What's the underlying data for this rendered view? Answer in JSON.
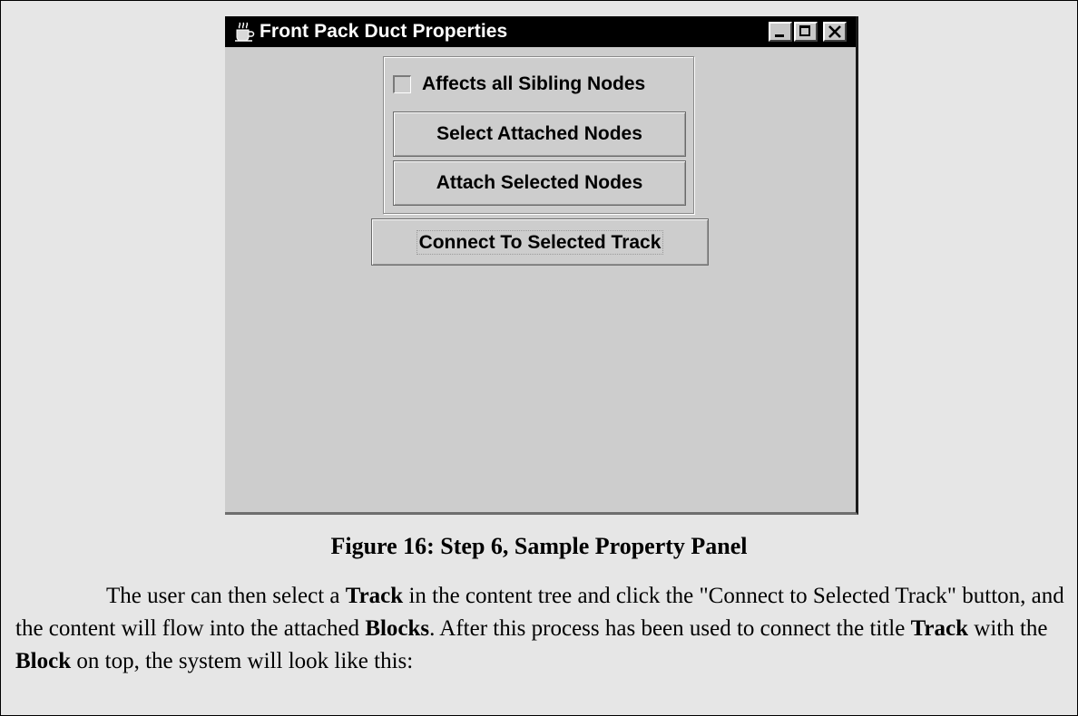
{
  "window": {
    "title": "Front Pack Duct Properties",
    "icon": "java-coffee-cup-icon",
    "controls": [
      "minimize",
      "maximize",
      "close"
    ]
  },
  "panel": {
    "checkbox": {
      "label": "Affects all Sibling Nodes",
      "checked": false
    },
    "select_attached_label": "Select Attached Nodes",
    "attach_selected_label": "Attach Selected Nodes",
    "connect_track_label": "Connect To Selected Track"
  },
  "document": {
    "caption": "Figure 16: Step 6, Sample Property Panel",
    "paragraph": [
      "The user can then select a ",
      "Track",
      " in the content tree and click the \"Connect to Selected Track\" button, and the content will flow into the attached ",
      "Blocks",
      ". After this process has been used to connect the title ",
      "Track",
      " with the ",
      "Block",
      " on top, the system will look like this:"
    ]
  }
}
